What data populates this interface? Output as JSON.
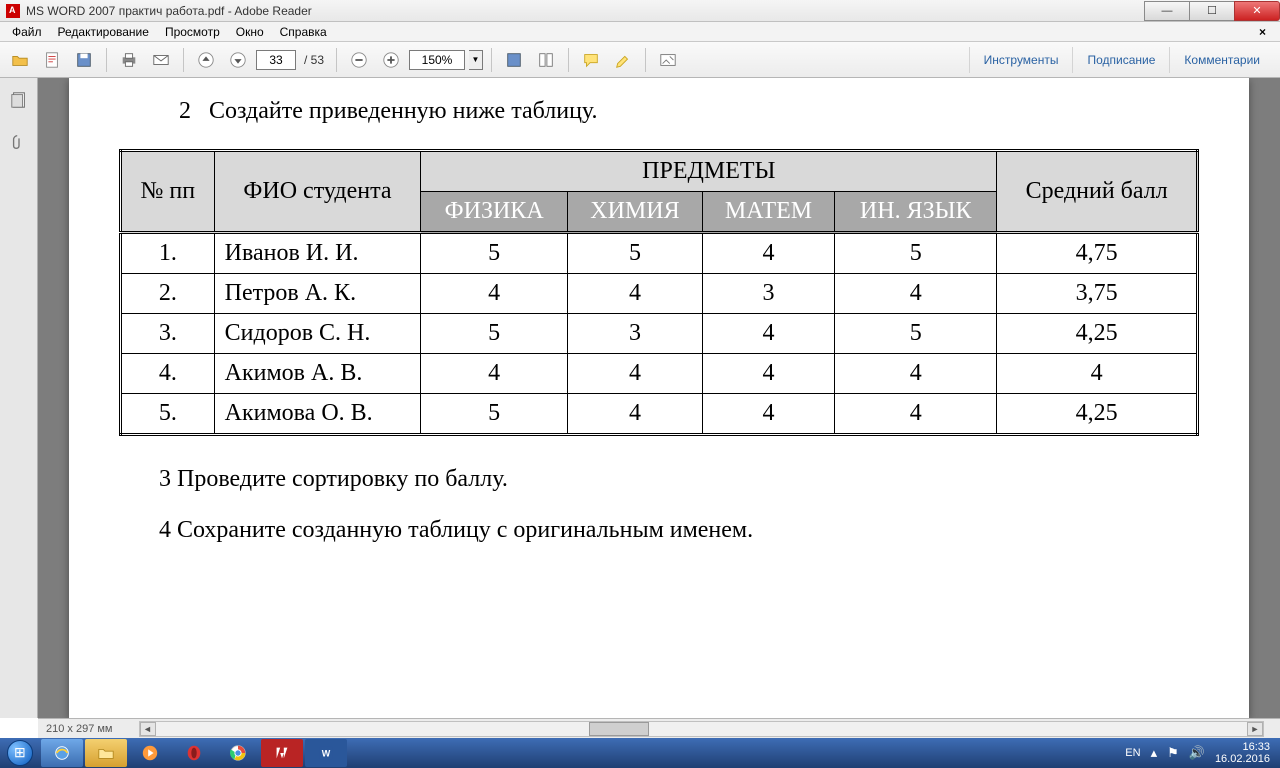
{
  "window": {
    "title": "MS WORD 2007 практич работа.pdf - Adobe Reader"
  },
  "menu": {
    "file": "Файл",
    "edit": "Редактирование",
    "view": "Просмотр",
    "window": "Окно",
    "help": "Справка"
  },
  "toolbar": {
    "page_current": "33",
    "page_total": "/ 53",
    "zoom": "150%",
    "right": {
      "tools": "Инструменты",
      "sign": "Подписание",
      "comments": "Комментарии"
    }
  },
  "document": {
    "task2_num": "2",
    "task2_text": "Создайте приведенную ниже таблицу.",
    "task3": "3 Проведите сортировку по баллу.",
    "task4": "4 Сохраните созданную таблицу с оригинальным именем.",
    "table": {
      "head": {
        "num": "№ пп",
        "fio": "ФИО студента",
        "subjects": "ПРЕДМЕТЫ",
        "physics": "ФИЗИКА",
        "chemistry": "ХИМИЯ",
        "math": "МАТЕМ",
        "lang": "ИН. ЯЗЫК",
        "avg": "Средний балл"
      },
      "rows": [
        {
          "n": "1.",
          "name": "Иванов И. И.",
          "p": "5",
          "c": "5",
          "m": "4",
          "l": "5",
          "a": "4,75"
        },
        {
          "n": "2.",
          "name": "Петров А. К.",
          "p": "4",
          "c": "4",
          "m": "3",
          "l": "4",
          "a": "3,75"
        },
        {
          "n": "3.",
          "name": "Сидоров С. Н.",
          "p": "5",
          "c": "3",
          "m": "4",
          "l": "5",
          "a": "4,25"
        },
        {
          "n": "4.",
          "name": "Акимов А. В.",
          "p": "4",
          "c": "4",
          "m": "4",
          "l": "4",
          "a": "4"
        },
        {
          "n": "5.",
          "name": "Акимова О. В.",
          "p": "5",
          "c": "4",
          "m": "4",
          "l": "4",
          "a": "4,25"
        }
      ]
    }
  },
  "status": {
    "dimensions": "210 x 297 мм"
  },
  "tray": {
    "lang": "EN",
    "time": "16:33",
    "date": "16.02.2016"
  }
}
